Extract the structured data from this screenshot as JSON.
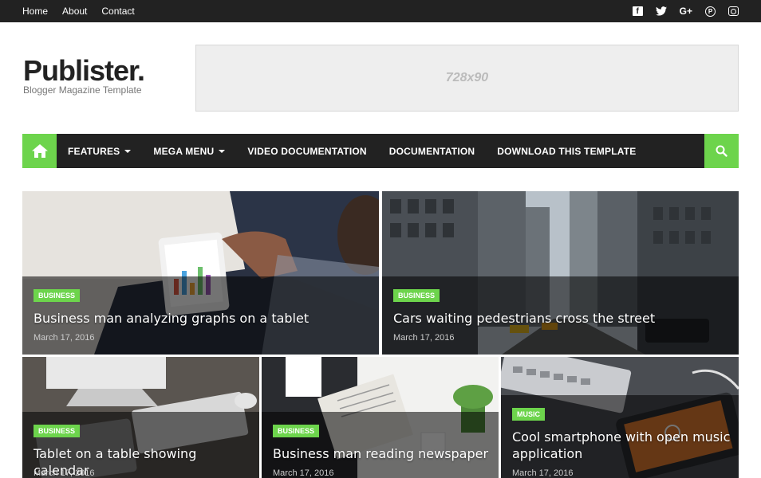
{
  "topbar": {
    "links": [
      "Home",
      "About",
      "Contact"
    ],
    "social_icons": [
      "facebook-icon",
      "twitter-icon",
      "google-plus-icon",
      "pinterest-icon",
      "instagram-icon"
    ],
    "social_glyphs": [
      "f",
      "",
      "G+",
      "P",
      ""
    ]
  },
  "header": {
    "logo_title": "Publister.",
    "logo_tagline": "Blogger Magazine Template",
    "ad_label": "728x90"
  },
  "menu": {
    "home_icon": "home-icon",
    "items": [
      {
        "label": "FEATURES",
        "has_dropdown": true
      },
      {
        "label": "MEGA MENU",
        "has_dropdown": true
      },
      {
        "label": "VIDEO DOCUMENTATION",
        "has_dropdown": false
      },
      {
        "label": "DOCUMENTATION",
        "has_dropdown": false
      },
      {
        "label": "DOWNLOAD THIS TEMPLATE",
        "has_dropdown": false
      }
    ],
    "search_icon": "search-icon"
  },
  "posts": [
    {
      "category": "BUSINESS",
      "title": "Business man analyzing graphs on a tablet",
      "date": "March 17, 2016"
    },
    {
      "category": "BUSINESS",
      "title": "Cars waiting pedestrians cross the street",
      "date": "March 17, 2016"
    },
    {
      "category": "BUSINESS",
      "title": "Tablet on a table showing calendar",
      "date": "March 17, 2016"
    },
    {
      "category": "BUSINESS",
      "title": "Business man reading newspaper",
      "date": "March 17, 2016"
    },
    {
      "category": "MUSIC",
      "title": "Cool smartphone with open music application",
      "date": "March 17, 2016"
    }
  ],
  "colors": {
    "accent": "#6dd44c",
    "dark": "#222222",
    "ad_bg": "#eeeeee"
  }
}
